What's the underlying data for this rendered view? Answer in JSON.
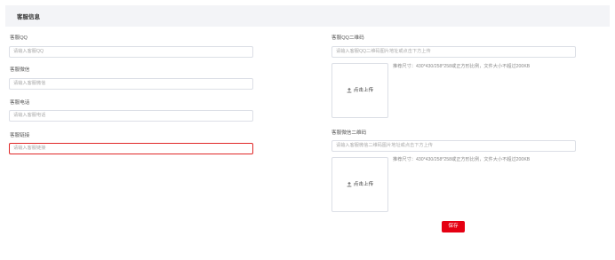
{
  "header": {
    "title": "客服信息"
  },
  "fields": {
    "qq": {
      "label": "客服QQ",
      "placeholder": "请输入客服QQ"
    },
    "wechat": {
      "label": "客服微信",
      "placeholder": "请输入客服微信"
    },
    "phone": {
      "label": "客服电话",
      "placeholder": "请输入客服电话"
    },
    "link": {
      "label": "客服链接",
      "placeholder": "请输入客服链接"
    }
  },
  "qq_qrcode": {
    "label": "客服QQ二维码",
    "placeholder": "请输入客服QQ二维码图片地址或点击下方上传",
    "upload_label": "点击上传",
    "hint": "推荐尺寸：430*430/258*258或正方形比例，文件大小不超过200KB"
  },
  "wechat_qrcode": {
    "label": "客服微信二维码",
    "placeholder": "请输入客服微信二维码图片地址或点击下方上传",
    "upload_label": "点击上传",
    "hint": "推荐尺寸：430*430/258*258或正方形比例，文件大小不超过200KB"
  },
  "actions": {
    "save_label": "保存"
  },
  "colors": {
    "accent": "#e50012",
    "header_bg": "#f3f4f7",
    "focus_border": "#e02828"
  }
}
